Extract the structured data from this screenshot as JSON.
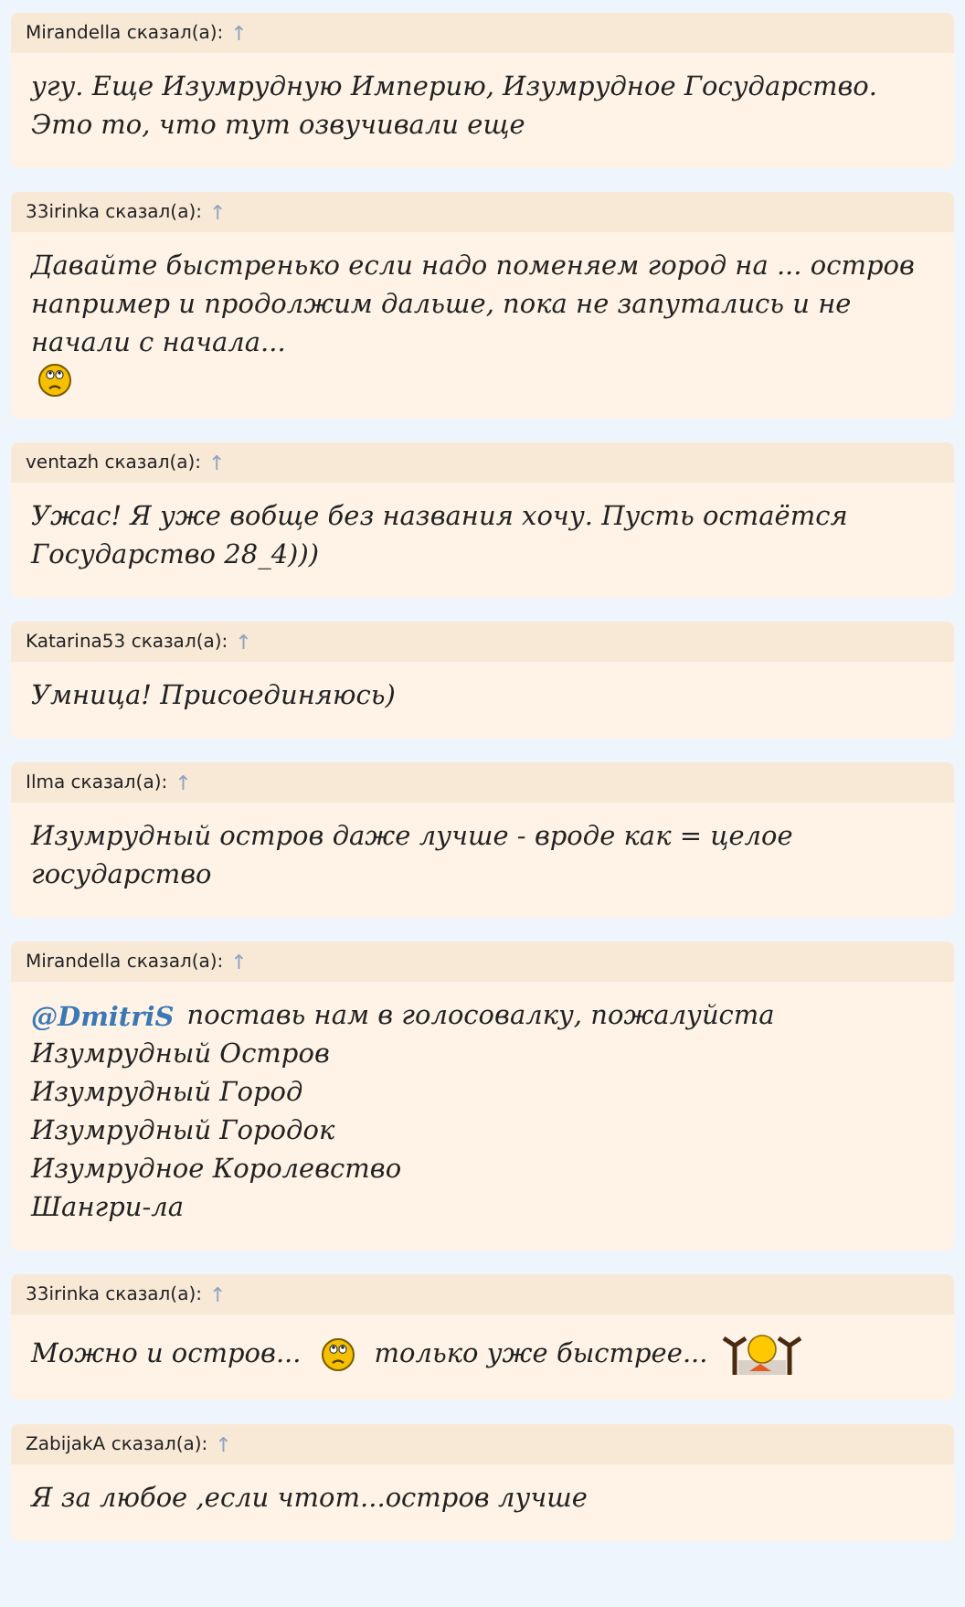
{
  "posts": [
    {
      "author": "Mirandella",
      "said": "сказал(а):",
      "arrow": "↑",
      "lines": [
        [
          {
            "kind": "text",
            "text": "угу. Еще Изумрудную Империю, Изумрудное Государство. Это то, что тут озвучивали еще"
          }
        ]
      ]
    },
    {
      "author": "33irinka",
      "said": "сказал(а):",
      "arrow": "↑",
      "lines": [
        [
          {
            "kind": "text",
            "text": "Давайте быстренько если надо поменяем город на ... остров например и продолжим дальше, пока не запутались и не начали с начала..."
          },
          {
            "kind": "worried"
          }
        ]
      ]
    },
    {
      "author": "ventazh",
      "said": "сказал(а):",
      "arrow": "↑",
      "lines": [
        [
          {
            "kind": "text",
            "text": "Ужас! Я уже вобще без названия хочу. Пусть остаётся Государство 28_4)))"
          }
        ]
      ]
    },
    {
      "author": "Katarina53",
      "said": "сказал(а):",
      "arrow": "↑",
      "lines": [
        [
          {
            "kind": "text",
            "text": "Умница! Присоединяюсь)"
          }
        ]
      ]
    },
    {
      "author": "Ilma",
      "said": "сказал(а):",
      "arrow": "↑",
      "lines": [
        [
          {
            "kind": "text",
            "text": "Изумрудный остров даже лучше - вроде как = целое государство"
          }
        ]
      ]
    },
    {
      "author": "Mirandella",
      "said": "сказал(а):",
      "arrow": "↑",
      "lines": [
        [
          {
            "kind": "mention",
            "text": "@DmitriS"
          },
          {
            "kind": "text",
            "text": "поставь нам в голосовалку, пожалуйста"
          }
        ],
        [
          {
            "kind": "text",
            "text": "Изумрудный Остров"
          }
        ],
        [
          {
            "kind": "text",
            "text": "Изумрудный Город"
          }
        ],
        [
          {
            "kind": "text",
            "text": "Изумрудный Городок"
          }
        ],
        [
          {
            "kind": "text",
            "text": "Изумрудное Королевство"
          }
        ],
        [
          {
            "kind": "text",
            "text": "Шангри-ла"
          }
        ]
      ]
    },
    {
      "author": "33irinka",
      "said": "сказал(а):",
      "arrow": "↑",
      "lines": [
        [
          {
            "kind": "text",
            "text": "Можно и остров..."
          },
          {
            "kind": "worried"
          },
          {
            "kind": "text",
            "text": "только уже быстрее..."
          },
          {
            "kind": "cheer"
          }
        ]
      ]
    },
    {
      "author": "ZabijakA",
      "said": "сказал(а):",
      "arrow": "↑",
      "lines": [
        [
          {
            "kind": "text",
            "text": "Я за любое ,если чтот...остров лучше"
          }
        ]
      ]
    }
  ]
}
